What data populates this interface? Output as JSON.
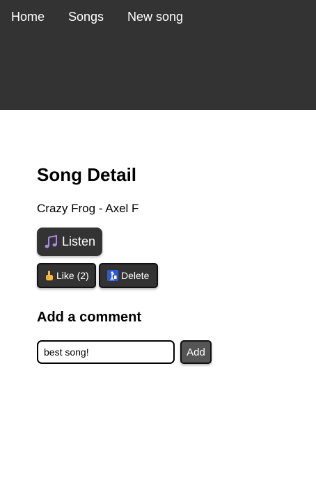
{
  "nav": {
    "items": [
      {
        "label": "Home"
      },
      {
        "label": "Songs"
      },
      {
        "label": "New song"
      }
    ]
  },
  "song_detail": {
    "title": "Song Detail",
    "song_name": "Crazy Frog - Axel F",
    "listen_label": "Listen",
    "like_label": "Like (2)",
    "delete_label": "Delete",
    "listen_icon": "music-notes-icon",
    "like_icon": "pointing-hand-icon",
    "delete_icon": "trash-icon"
  },
  "comment": {
    "title": "Add a comment",
    "input_value": "best song!",
    "add_label": "Add"
  },
  "colors": {
    "topbar": "#333333",
    "button_dark": "#333333",
    "button_add": "#555555"
  }
}
